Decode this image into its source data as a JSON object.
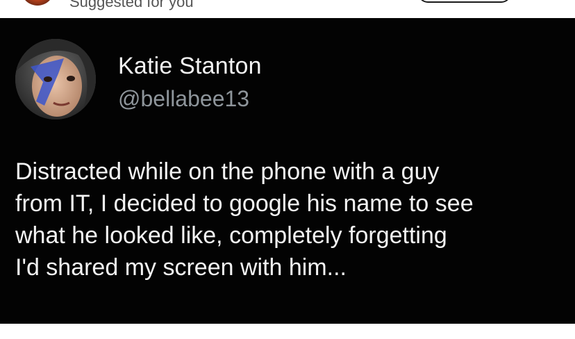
{
  "feed_header": {
    "suggested_label": "Suggested for you",
    "avatar_icon": "profile-avatar-icon",
    "follow_button_label": ""
  },
  "tweet": {
    "author_name": "Katie Stanton",
    "author_handle": "@bellabee13",
    "avatar_icon": "profile-photo-icon",
    "text": "Distracted while on the phone with a guy\nfrom IT, I decided to google his name to see\nwhat he looked like, completely forgetting\nI'd shared my screen with him..."
  },
  "colors": {
    "tweet_background": "#030303",
    "name_color": "#f2f2f2",
    "handle_color": "#8e959b",
    "text_color": "#f4f4f4"
  }
}
